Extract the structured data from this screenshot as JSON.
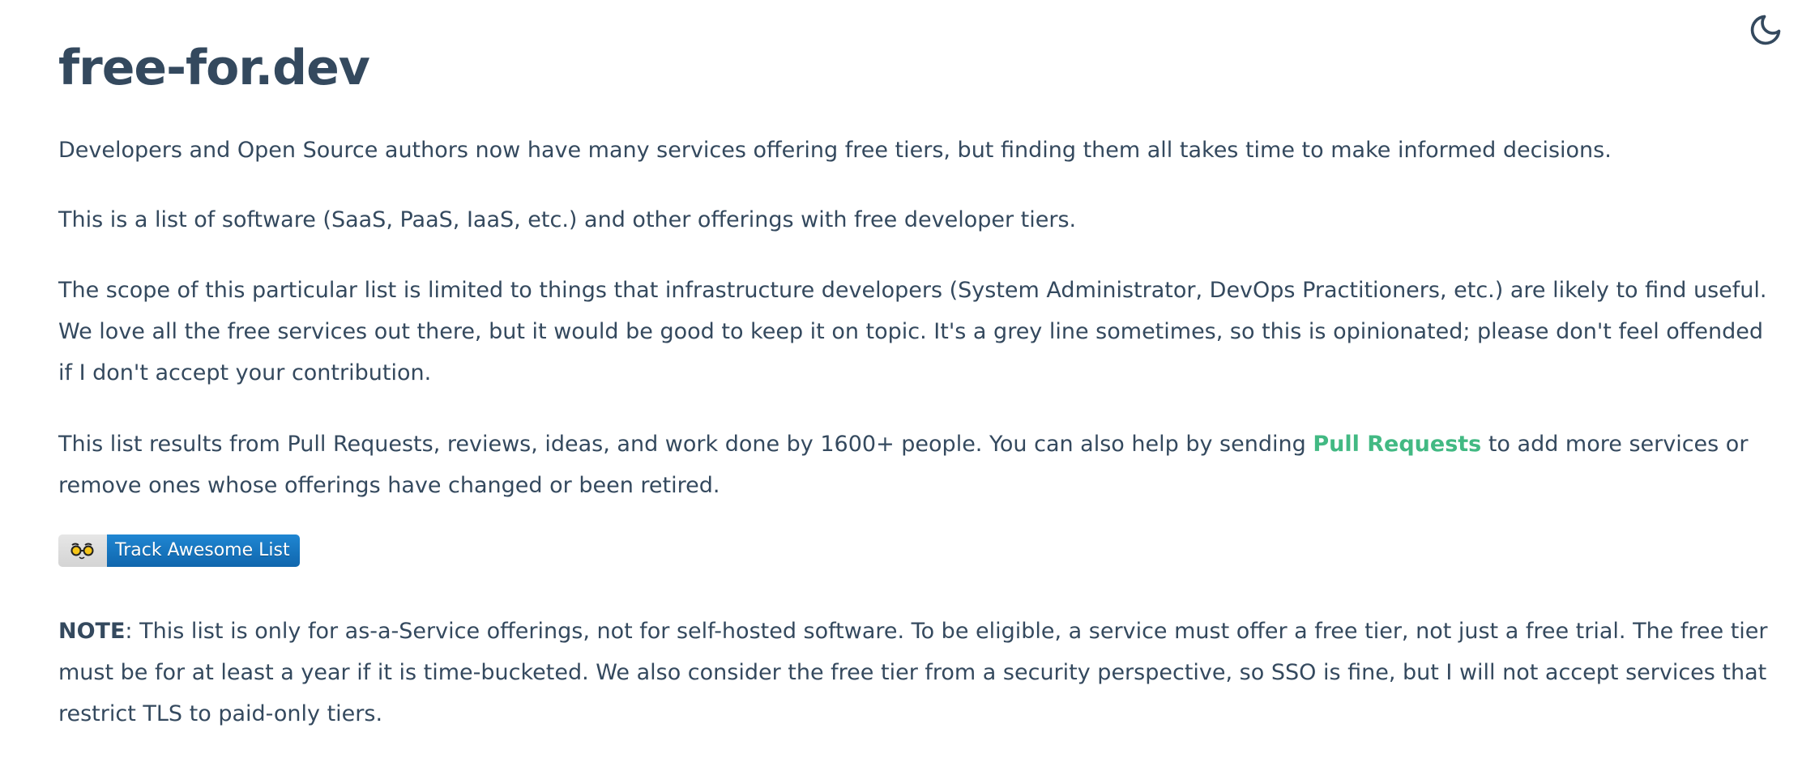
{
  "theme_toggle": {
    "icon": "moon-icon"
  },
  "page": {
    "title": "free-for.dev",
    "paragraphs": {
      "p1": "Developers and Open Source authors now have many services offering free tiers, but finding them all takes time to make informed decisions.",
      "p2": "This is a list of software (SaaS, PaaS, IaaS, etc.) and other offerings with free developer tiers.",
      "p3": "The scope of this particular list is limited to things that infrastructure developers (System Administrator, DevOps Practitioners, etc.) are likely to find useful. We love all the free services out there, but it would be good to keep it on topic. It's a grey line sometimes, so this is opinionated; please don't feel offended if I don't accept your contribution.",
      "p4_before": "This list results from Pull Requests, reviews, ideas, and work done by 1600+ people. You can also help by sending ",
      "p4_link": "Pull Requests",
      "p4_after": " to add more services or remove ones whose offerings have changed or been retired.",
      "note_label": "NOTE",
      "note_text": ": This list is only for as-a-Service offerings, not for self-hosted software. To be eligible, a service must offer a free tier, not just a free trial. The free tier must be for at least a year if it is time-bucketed. We also consider the free tier from a security perspective, so SSO is fine, but I will not accept services that restrict TLS to paid-only tiers."
    },
    "badge": {
      "icon": "eyeglasses-icon",
      "label": "Track Awesome List"
    }
  },
  "colors": {
    "text": "#34495e",
    "link": "#42b983",
    "badge_blue": "#1b7cc4"
  }
}
